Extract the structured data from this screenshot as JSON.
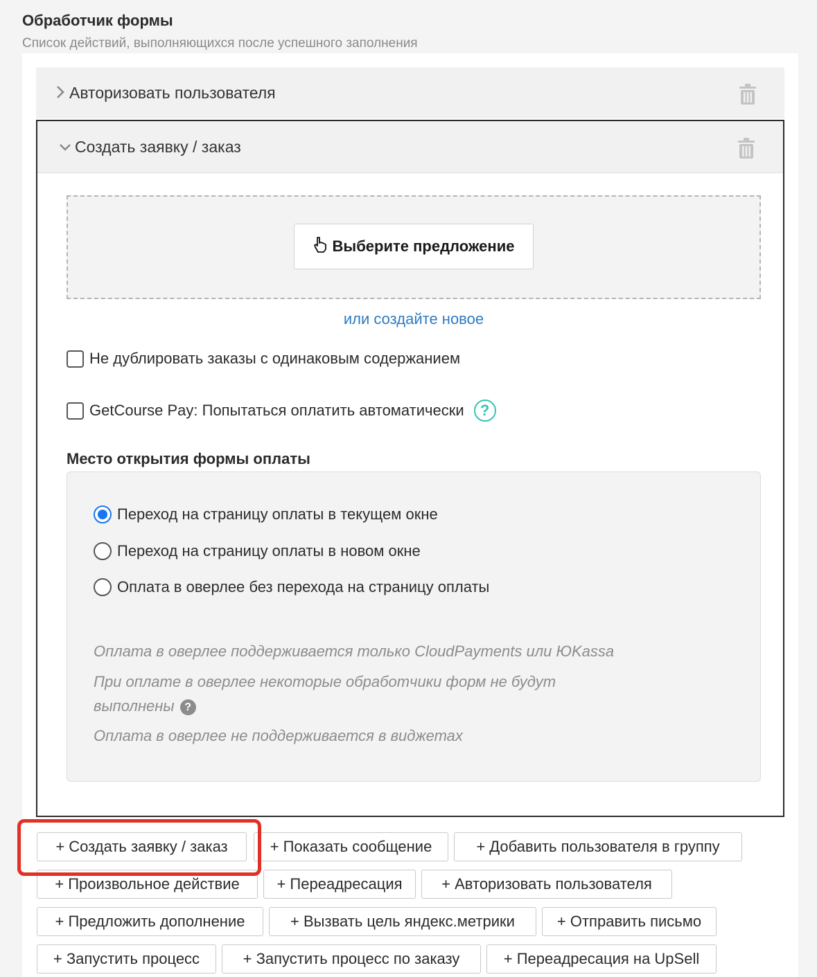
{
  "header": {
    "title": "Обработчик формы",
    "subtitle": "Список действий, выполняющихся после успешного заполнения"
  },
  "items": [
    {
      "label": "Авторизовать пользователя",
      "expanded": false
    },
    {
      "label": "Создать заявку / заказ",
      "expanded": true
    }
  ],
  "offer": {
    "select_button": "Выберите предложение",
    "create_new_link": "или создайте новое"
  },
  "options": {
    "no_duplicate": {
      "label": "Не дублировать заказы с одинаковым содержанием",
      "checked": false
    },
    "gc_pay": {
      "label": "GetCourse Pay: Попытаться оплатить автоматически",
      "checked": false
    }
  },
  "payment_place": {
    "label": "Место открытия формы оплаты",
    "choices": [
      {
        "label": "Переход на страницу оплаты в текущем окне",
        "selected": true
      },
      {
        "label": "Переход на страницу оплаты в новом окне",
        "selected": false
      },
      {
        "label": "Оплата в оверлее без перехода на страницу оплаты",
        "selected": false
      }
    ],
    "notes": {
      "n1": "Оплата в оверлее поддерживается только CloudPayments или ЮKassa",
      "n2_line1": "При оплате в оверлее некоторые обработчики форм не будут",
      "n2_line2": "выполнены",
      "n3": "Оплата в оверлее не поддерживается в виджетах"
    }
  },
  "actions": [
    "+ Создать заявку / заказ",
    "+ Показать сообщение",
    "+ Добавить пользователя в группу",
    "+ Произвольное действие",
    "+ Переадресация",
    "+ Авторизовать пользователя",
    "+ Предложить дополнение",
    "+ Вызвать цель яндекс.метрики",
    "+ Отправить письмо",
    "+ Запустить процесс",
    "+ Запустить процесс по заказу",
    "+ Переадресация на UpSell"
  ],
  "colors": {
    "link": "#2e7bbf",
    "help": "#36c3b4",
    "radio_selected": "#1976f0",
    "highlight": "#e03128"
  }
}
